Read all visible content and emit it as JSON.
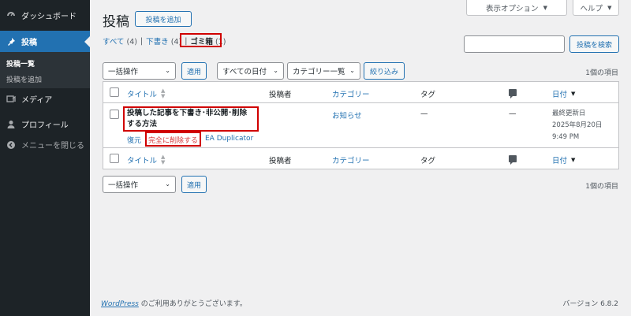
{
  "sidebar": {
    "items": [
      {
        "label": "ダッシュボード",
        "icon": "dashboard-icon"
      },
      {
        "label": "投稿",
        "icon": "pin-icon"
      },
      {
        "label": "メディア",
        "icon": "media-icon"
      },
      {
        "label": "プロフィール",
        "icon": "user-icon"
      }
    ],
    "submenu": [
      {
        "label": "投稿一覧"
      },
      {
        "label": "投稿を追加"
      }
    ],
    "collapse_label": "メニューを閉じる"
  },
  "screen_options": {
    "label": "表示オプション"
  },
  "help": {
    "label": "ヘルプ"
  },
  "page_title": "投稿",
  "add_new_label": "投稿を追加",
  "views": {
    "all": {
      "label": "すべて",
      "count": "(4)"
    },
    "draft": {
      "label": "下書き",
      "count": "(4)"
    },
    "trash": {
      "label": "ゴミ箱",
      "count": "(1)"
    },
    "separator": "|"
  },
  "search": {
    "button_label": "投稿を検索",
    "value": ""
  },
  "toolbar_top": {
    "bulk_action": "一括操作",
    "apply": "適用",
    "date_filter": "すべての日付",
    "category_filter": "カテゴリー一覧",
    "filter_button": "絞り込み",
    "items_count": "1個の項目"
  },
  "table": {
    "columns": {
      "title": "タイトル",
      "author": "投稿者",
      "category": "カテゴリー",
      "tags": "タグ",
      "date": "日付"
    },
    "rows": [
      {
        "title_line1": "投稿した記事を下書き･非公開･削除",
        "title_line2": "する方法",
        "author": "",
        "category": "お知らせ",
        "tags": "—",
        "comments": "—",
        "date_status": "最終更新日",
        "date": "2025年8月20日",
        "time": "9:49 PM",
        "actions": {
          "restore": "復元",
          "delete_permanently": "完全に削除する",
          "duplicator": "EA Duplicator"
        }
      }
    ]
  },
  "toolbar_bottom": {
    "bulk_action": "一括操作",
    "apply": "適用",
    "items_count": "1個の項目"
  },
  "footer": {
    "wp_link": "WordPress",
    "thanks_text": " のご利用ありがとうございます。",
    "version": "バージョン 6.8.2"
  },
  "colors": {
    "sidebar_bg": "#1d2327",
    "accent": "#2271b1",
    "highlight_box": "#d00000",
    "danger": "#d63638"
  }
}
